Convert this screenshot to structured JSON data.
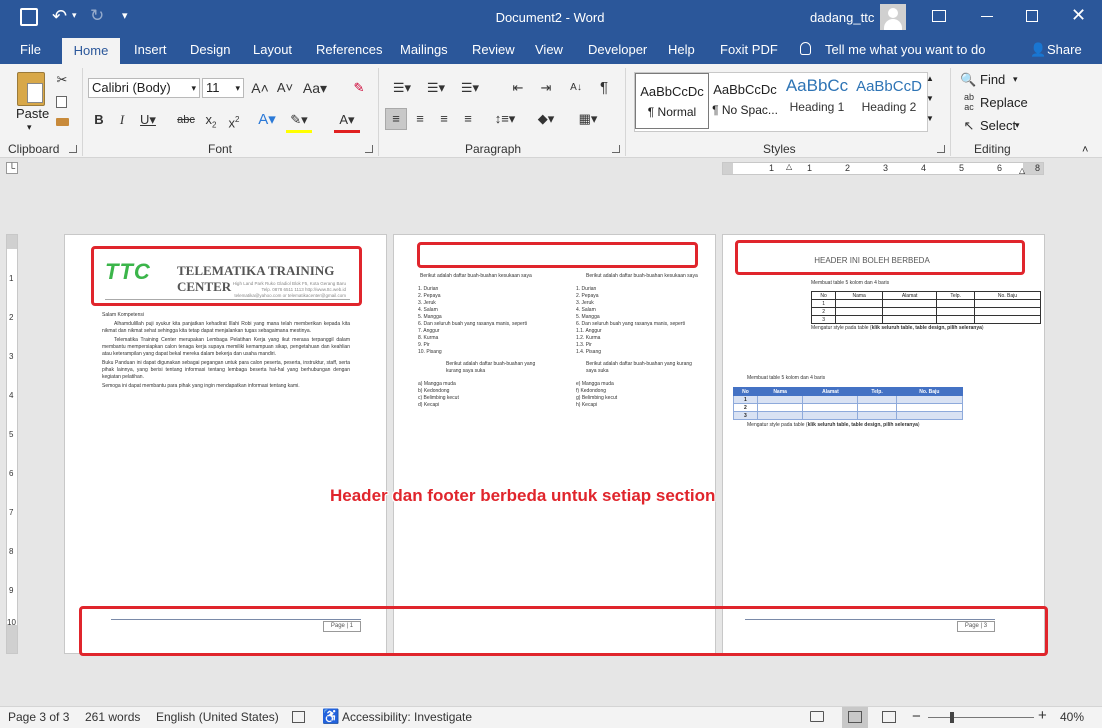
{
  "title": "Document2  -  Word",
  "user": "dadang_ttc",
  "tabs": [
    "File",
    "Home",
    "Insert",
    "Design",
    "Layout",
    "References",
    "Mailings",
    "Review",
    "View",
    "Developer",
    "Help",
    "Foxit PDF"
  ],
  "tell_me": "Tell me what you want to do",
  "share": "Share",
  "clipboard": {
    "paste": "Paste",
    "label": "Clipboard"
  },
  "font": {
    "name": "Calibri (Body)",
    "size": "11",
    "label": "Font"
  },
  "paragraph": {
    "label": "Paragraph"
  },
  "styles": {
    "label": "Styles",
    "items": [
      {
        "preview": "AaBbCcDc",
        "name": "¶ Normal"
      },
      {
        "preview": "AaBbCcDc",
        "name": "¶ No Spac..."
      },
      {
        "preview": "AaBbCc",
        "name": "Heading 1"
      },
      {
        "preview": "AaBbCcD",
        "name": "Heading 2"
      }
    ]
  },
  "editing": {
    "label": "Editing",
    "find": "Find",
    "replace": "Replace",
    "select": "Select"
  },
  "ruler": {
    "h": [
      "1",
      "1",
      "2",
      "3",
      "4",
      "5",
      "6",
      "7",
      "8"
    ],
    "v": [
      "1",
      "2",
      "3",
      "4",
      "5",
      "6",
      "7",
      "8",
      "9",
      "10"
    ]
  },
  "page1": {
    "logo": "TTC",
    "org": "TELEMATIKA TRAINING CENTER",
    "addr1": "High Land Park Ruko Gladiol Blok F5, Kota Gerang Baru",
    "addr2": "Telp. 0878 6511 1113  http://www.ttc.web.id",
    "addr3": "telematika@yahoo.com or telematikacenter@gmail.com",
    "greeting": "Salam Kompetensi",
    "p1": "Alhamdulillah puji syukur kita panjatkan kehadirat Illahi Robi yang mana telah memberikan kepada kita nikmat dan nikmat sehat sehingga kita tetap dapat menjalankan tugas sebagaimana mestinya.",
    "p2": "Telematika Training Center merupakan Lembaga Pelatihan Kerja yang ikut merasa terpanggil dalam membantu mempersiapkan calon tenaga kerja supaya memiliki kemampuan sikap, pengetahuan dan keahlian atau keterampilan yang dapat bekal mereka dalam bekerja dan usaha mandiri.",
    "p3": "Buku Panduan ini dapat digunakan sebagai pegangan untuk para calon peserta, peserta, instruktur, staff, serta pihak lainnya, yang berisi tentang informasi tentang lembaga beserta hal-hal yang berhubungan dengan kegiatan pelatihan.",
    "p4": "Semoga ini dapat membantu para pihak yang ingin mendapatkan informasi tentang kami.",
    "footer": "Page | 1"
  },
  "page2": {
    "intro": "Berikut adalah daftar buah-buahan kesukaan saya",
    "listA": [
      "1.  Durian",
      "2.  Pepaya",
      "3.  Jeruk",
      "4.  Salam",
      "5.  Mangga",
      "6.  Dan seluruh buah yang rasanya manis, seperti",
      "7.  Anggur",
      "8.  Kurma",
      "9.  Pir",
      "10. Pisang"
    ],
    "listB": [
      "1.  Durian",
      "2.  Pepaya",
      "3.  Jeruk",
      "4.  Salam",
      "5.  Mangga",
      "6.  Dan seluruh buah yang rasanya manis, seperti",
      "1.1. Anggur",
      "1.2. Kurma",
      "1.3. Pir",
      "1.4. Pisang"
    ],
    "intro2a": "Berikut adalah daftar buah-buahan yang kurang saya suka",
    "intro2b": "Berikut adalah daftar buah-buahan yang kurang saya suka",
    "listC": [
      "a)  Mangga muda",
      "b)  Kedondong",
      "c)  Belimbing kecut",
      "d)  Kecapi"
    ],
    "listD": [
      "e)  Mangga muda",
      "f)  Kedondong",
      "g)  Belimbing kecut",
      "h)  Kecapi"
    ]
  },
  "page3": {
    "header": "HEADER INI BOLEH BERBEDA",
    "t1cap": "Membuat table 5 kolom dan 4 baris",
    "cols": [
      "No",
      "Nama",
      "Alamat",
      "Telp.",
      "No. Baju"
    ],
    "rows": [
      "1",
      "2",
      "3"
    ],
    "t1note_pre": "Mengatur style pada table (",
    "t1note_bold": "klik seluruh table,  table design, pilih seleranya",
    "t1note_post": ")",
    "t2cap": "Membuat table 5 kolom dan 4 baris",
    "t2note_pre": "Mengatur style pada table (",
    "t2note_bold": "klik seluruh table,  table design, pilih seleranya",
    "t2note_post": ")",
    "footer": "Page | 3"
  },
  "annotation": "Header dan footer berbeda untuk setiap section",
  "status": {
    "page": "Page 3 of 3",
    "words": "261 words",
    "lang": "English (United States)",
    "access": "Accessibility: Investigate",
    "zoom": "40%"
  },
  "colors": {
    "accent": "#2b579a",
    "highlight": "#e0252c",
    "table_head": "#4472c4"
  }
}
